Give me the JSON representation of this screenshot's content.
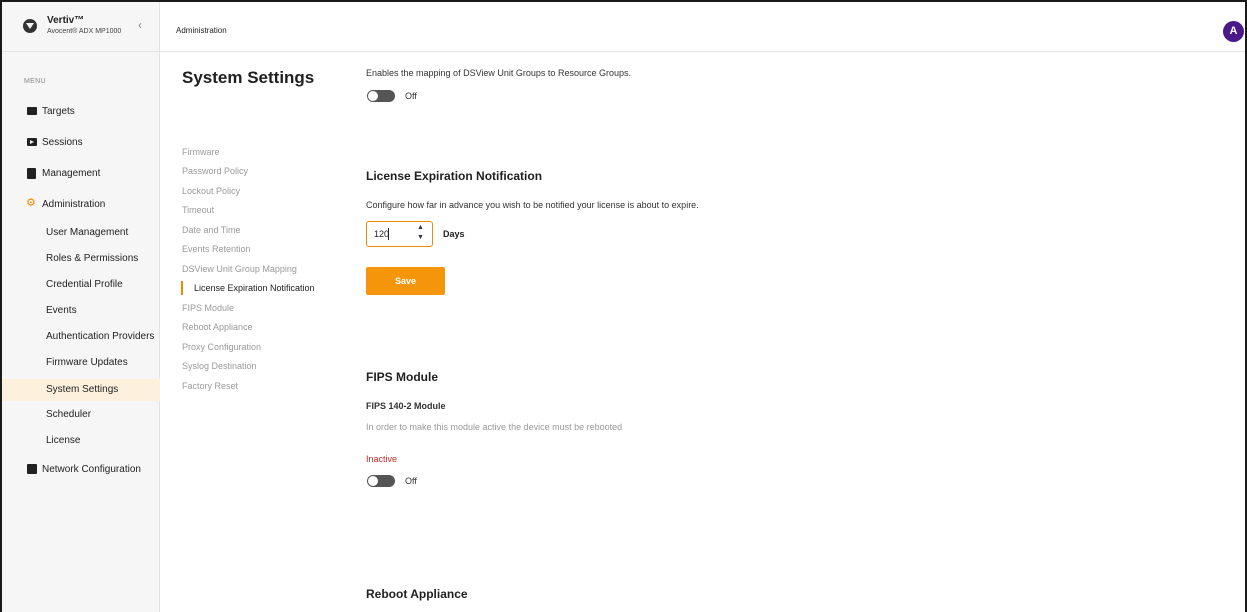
{
  "brand": {
    "name": "Vertiv™",
    "product": "Avocent® ADX MP1000"
  },
  "sidebar": {
    "menu_label": "MENU",
    "items": [
      {
        "label": "Targets",
        "icon": "server-icon"
      },
      {
        "label": "Sessions",
        "icon": "play-icon"
      },
      {
        "label": "Management",
        "icon": "clipboard-icon"
      },
      {
        "label": "Administration",
        "icon": "gear-icon"
      },
      {
        "label": "Network Configuration",
        "icon": "network-icon"
      }
    ],
    "admin_subitems": [
      "User Management",
      "Roles & Permissions",
      "Credential Profile",
      "Events",
      "Authentication Providers",
      "Firmware Updates",
      "System Settings",
      "Scheduler",
      "License"
    ],
    "active_subitem": "System Settings"
  },
  "topbar": {
    "breadcrumb": "Administration",
    "avatar_initial": "A"
  },
  "settings": {
    "title": "System Settings",
    "nav": [
      "Firmware",
      "Password Policy",
      "Lockout Policy",
      "Timeout",
      "Date and Time",
      "Events Retention",
      "DSView Unit Group Mapping",
      "License Expiration Notification",
      "FIPS Module",
      "Reboot Appliance",
      "Proxy Configuration",
      "Syslog Destination",
      "Factory Reset"
    ],
    "active_nav": "License Expiration Notification"
  },
  "dsview": {
    "description": "Enables the mapping of DSView Unit Groups to Resource Groups.",
    "toggle_label": "Off"
  },
  "license": {
    "title": "License Expiration Notification",
    "description": "Configure how far in advance you wish to be notified your license is about to expire.",
    "value": "120",
    "unit": "Days",
    "save_label": "Save"
  },
  "fips": {
    "title": "FIPS Module",
    "subtitle": "FIPS 140-2 Module",
    "note": "In order to make this module active the device must be rebooted",
    "status": "Inactive",
    "toggle_label": "Off"
  },
  "reboot": {
    "title": "Reboot Appliance"
  },
  "colors": {
    "accent": "#f28a00",
    "button": "#f5960a",
    "avatar": "#4a1a8a",
    "inactive": "#c32a2a"
  }
}
